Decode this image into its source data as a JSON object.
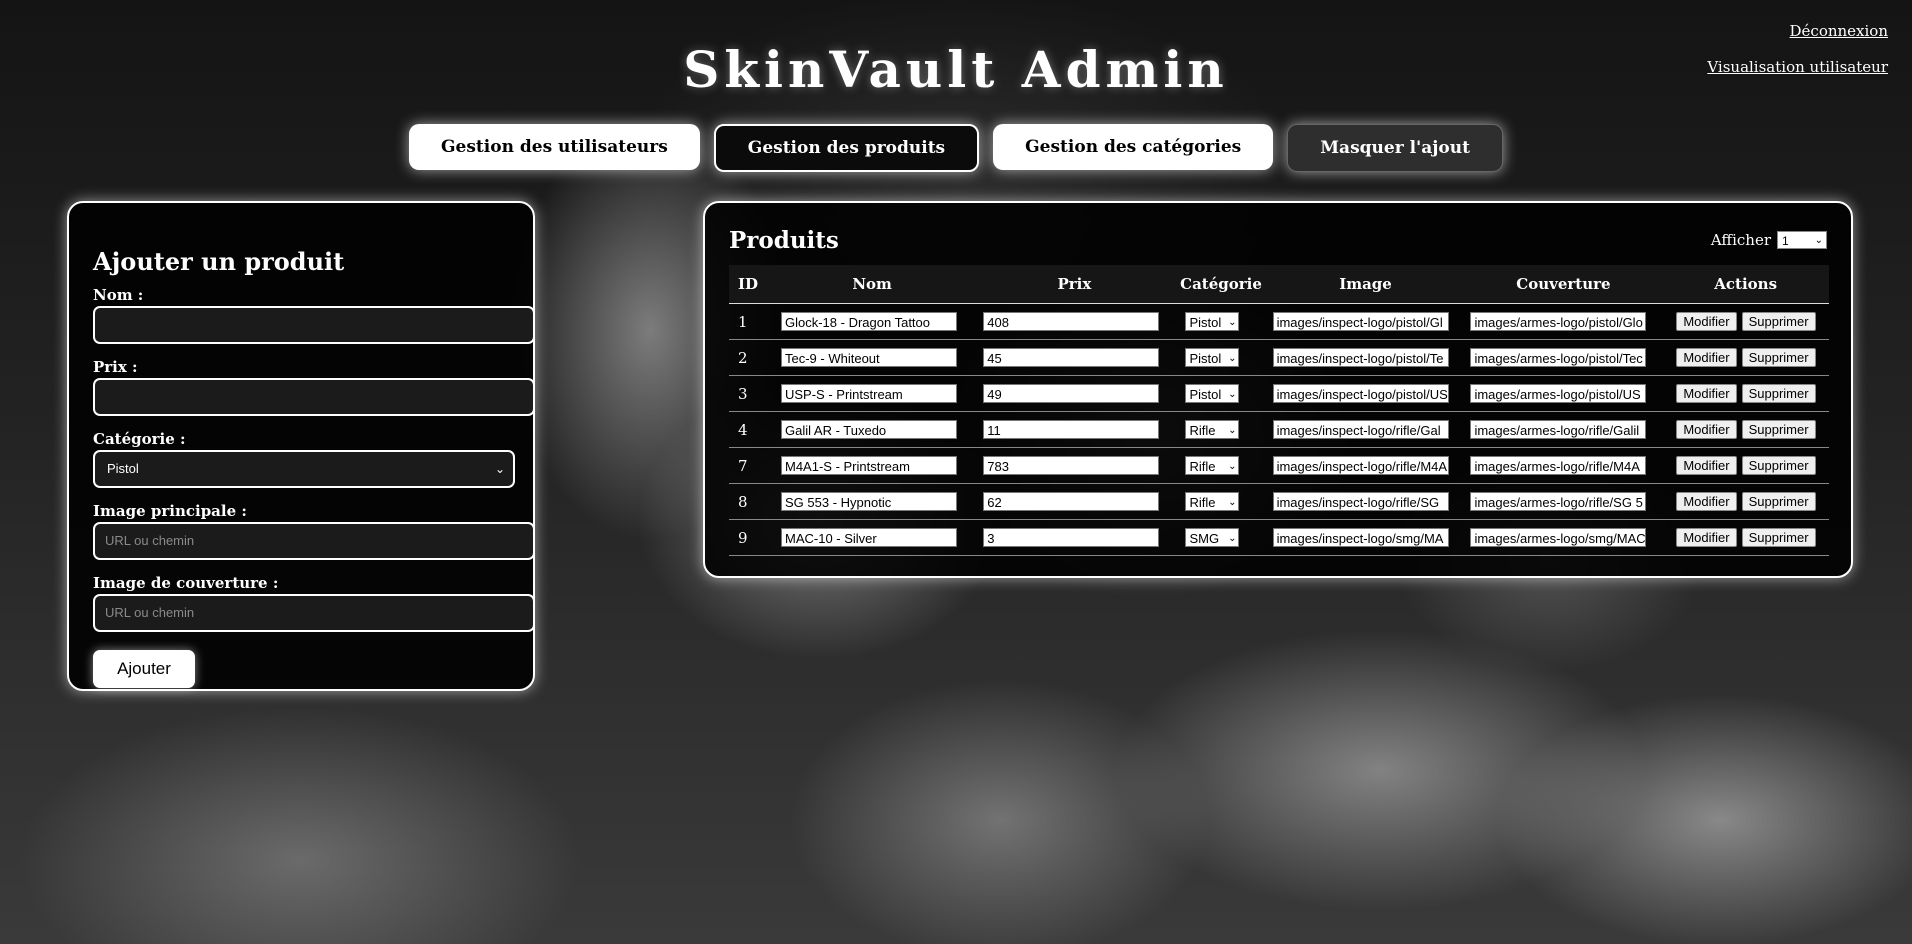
{
  "header": {
    "title": "SkinVault Admin",
    "logout_label": "Déconnexion",
    "user_view_label": "Visualisation utilisateur"
  },
  "nav": {
    "users": "Gestion des utilisateurs",
    "products": "Gestion des produits",
    "categories": "Gestion des catégories",
    "hide_add": "Masquer l'ajout"
  },
  "add_form": {
    "title": "Ajouter un produit",
    "name_label": "Nom :",
    "price_label": "Prix :",
    "category_label": "Catégorie :",
    "category_value": "Pistol",
    "image_label": "Image principale :",
    "image_placeholder": "URL ou chemin",
    "cover_label": "Image de couverture :",
    "cover_placeholder": "URL ou chemin",
    "submit_label": "Ajouter"
  },
  "products": {
    "title": "Produits",
    "show_label": "Afficher",
    "show_value": "1",
    "columns": [
      "ID",
      "Nom",
      "Prix",
      "Catégorie",
      "Image",
      "Couverture",
      "Actions"
    ],
    "edit_label": "Modifier",
    "delete_label": "Supprimer",
    "rows": [
      {
        "id": "1",
        "name": "Glock-18 - Dragon Tattoo",
        "price": "408",
        "category": "Pistol",
        "image": "images/inspect-logo/pistol/Gl",
        "cover": "images/armes-logo/pistol/Glo"
      },
      {
        "id": "2",
        "name": "Tec-9 - Whiteout",
        "price": "45",
        "category": "Pistol",
        "image": "images/inspect-logo/pistol/Te",
        "cover": "images/armes-logo/pistol/Tec"
      },
      {
        "id": "3",
        "name": "USP-S - Printstream",
        "price": "49",
        "category": "Pistol",
        "image": "images/inspect-logo/pistol/US",
        "cover": "images/armes-logo/pistol/US"
      },
      {
        "id": "4",
        "name": "Galil AR - Tuxedo",
        "price": "11",
        "category": "Rifle",
        "image": "images/inspect-logo/rifle/Gal",
        "cover": "images/armes-logo/rifle/Galil"
      },
      {
        "id": "7",
        "name": "M4A1-S - Printstream",
        "price": "783",
        "category": "Rifle",
        "image": "images/inspect-logo/rifle/M4A",
        "cover": "images/armes-logo/rifle/M4A"
      },
      {
        "id": "8",
        "name": "SG 553 - Hypnotic",
        "price": "62",
        "category": "Rifle",
        "image": "images/inspect-logo/rifle/SG",
        "cover": "images/armes-logo/rifle/SG 5"
      },
      {
        "id": "9",
        "name": "MAC-10 - Silver",
        "price": "3",
        "category": "SMG",
        "image": "images/inspect-logo/smg/MA",
        "cover": "images/armes-logo/smg/MAC"
      }
    ]
  },
  "icons": {
    "select_arrow": "chevron-down-icon"
  }
}
